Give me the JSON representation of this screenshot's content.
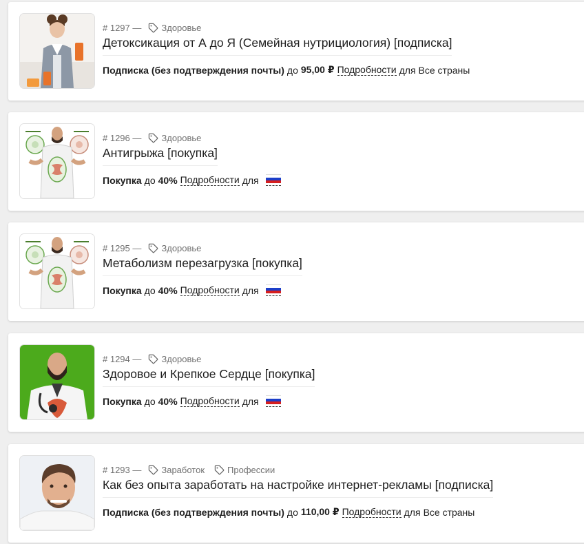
{
  "cards": [
    {
      "number": "# 1297 —",
      "tags": [
        "Здоровье"
      ],
      "title": "Детоксикация от А до Я (Семейная нутрициология) [подписка]",
      "type": "Подписка (без подтверждения почты)",
      "upto": "до",
      "amount": "95,00 ₽",
      "details": "Подробности",
      "for": "для",
      "countries": "Все страны",
      "thumb_icon": "woman-with-juice-image"
    },
    {
      "number": "# 1296 —",
      "tags": [
        "Здоровье"
      ],
      "title": "Антигрыжа [покупка]",
      "type": "Покупка",
      "upto": "до",
      "amount": "40%",
      "details": "Подробности",
      "for": "для",
      "countries": "",
      "flag": "russia-flag",
      "thumb_icon": "doctor-diagram-image"
    },
    {
      "number": "# 1295 —",
      "tags": [
        "Здоровье"
      ],
      "title": "Метаболизм перезагрузка [покупка]",
      "type": "Покупка",
      "upto": "до",
      "amount": "40%",
      "details": "Подробности",
      "for": "для",
      "countries": "",
      "flag": "russia-flag",
      "thumb_icon": "doctor-diagram-image"
    },
    {
      "number": "# 1294 —",
      "tags": [
        "Здоровье"
      ],
      "title": "Здоровое и Крепкое Сердце [покупка]",
      "type": "Покупка",
      "upto": "до",
      "amount": "40%",
      "details": "Подробности",
      "for": "для",
      "countries": "",
      "flag": "russia-flag",
      "thumb_icon": "doctor-heart-image"
    },
    {
      "number": "# 1293 —",
      "tags": [
        "Заработок",
        "Профессии"
      ],
      "title": "Как без опыта заработать на настройке интернет-рекламы [подписка]",
      "type": "Подписка (без подтверждения почты)",
      "upto": "до",
      "amount": "110,00 ₽",
      "details": "Подробности",
      "for": "для",
      "countries": "Все страны",
      "thumb_icon": "man-portrait-image"
    }
  ],
  "colors": {
    "background": "#efefef",
    "card": "#ffffff",
    "meta_text": "#707070",
    "green_bg": "#4caa1c",
    "flag_white": "#ffffff",
    "flag_blue": "#1c3ec9",
    "flag_red": "#d61f1f"
  }
}
